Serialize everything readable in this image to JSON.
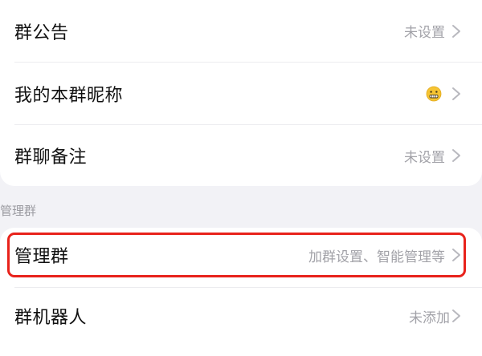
{
  "settings": {
    "items": [
      {
        "label": "群公告",
        "value": "未设置",
        "icon": "chevron-right-icon"
      },
      {
        "label": "我的本群昵称",
        "value": "",
        "icon": "grimace-emoji-icon"
      },
      {
        "label": "群聊备注",
        "value": "未设置",
        "icon": "chevron-right-icon"
      }
    ]
  },
  "manage_section": {
    "header": "管理群",
    "items": [
      {
        "label": "管理群",
        "value": "加群设置、智能管理等",
        "icon": "chevron-right-icon"
      },
      {
        "label": "群机器人",
        "value": "未添加",
        "icon": "chevron-right-icon"
      }
    ]
  },
  "colors": {
    "background": "#f2f2f6",
    "card": "#ffffff",
    "highlight_border": "#e8221b",
    "secondary_text": "#a2a2a8"
  }
}
